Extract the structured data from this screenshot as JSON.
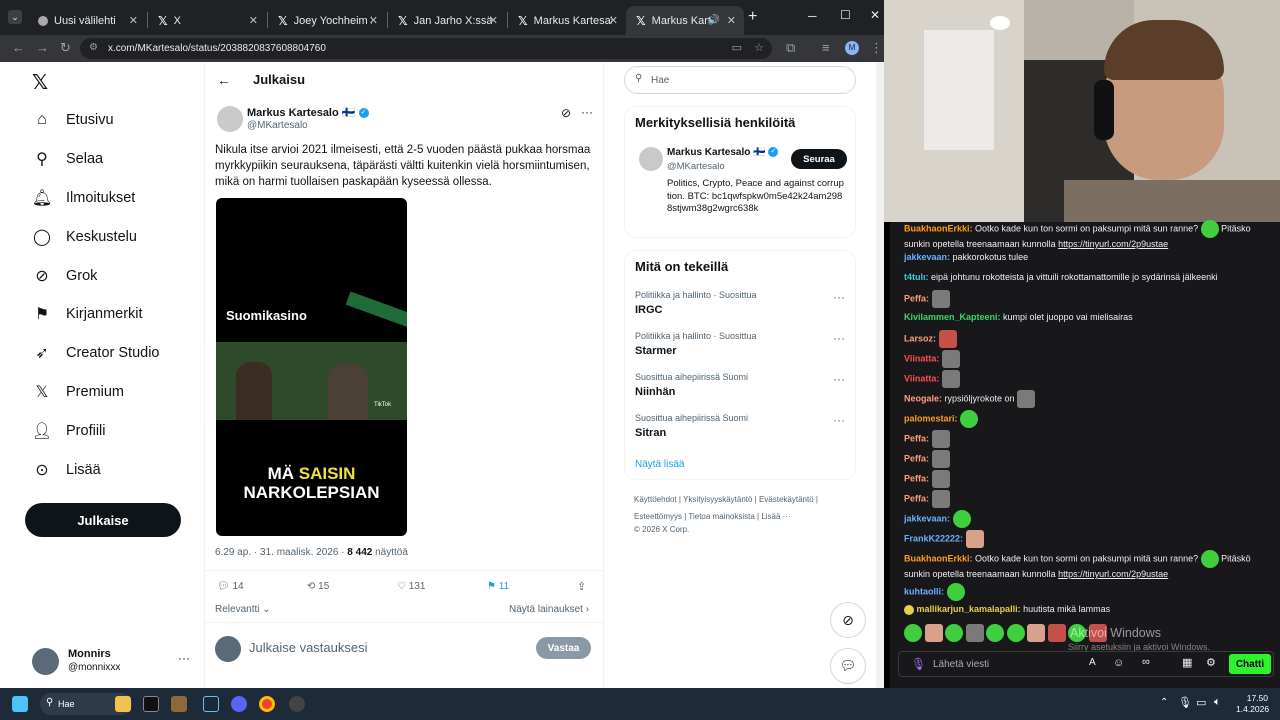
{
  "browser": {
    "tabs": [
      {
        "label": "Uusi välilehti"
      },
      {
        "label": "X"
      },
      {
        "label": "Joey Yochheim X:ssä"
      },
      {
        "label": "Jan Jarho X:ssä: \"Tän"
      },
      {
        "label": "Markus Kartesalo X"
      },
      {
        "label": "Markus Kartesalo X"
      }
    ],
    "url": "x.com/MKartesalo/status/2038820837608804760"
  },
  "leftnav": {
    "items": [
      {
        "label": "Etusivu",
        "icon": "home-icon"
      },
      {
        "label": "Selaa",
        "icon": "search-icon"
      },
      {
        "label": "Ilmoitukset",
        "icon": "bell-icon"
      },
      {
        "label": "Keskustelu",
        "icon": "chat-icon"
      },
      {
        "label": "Grok",
        "icon": "grok-icon"
      },
      {
        "label": "Kirjanmerkit",
        "icon": "bookmark-icon"
      },
      {
        "label": "Creator Studio",
        "icon": "rocket-icon"
      },
      {
        "label": "Premium",
        "icon": "x-icon"
      },
      {
        "label": "Profiili",
        "icon": "person-icon"
      },
      {
        "label": "Lisää",
        "icon": "more-circle-icon"
      }
    ],
    "post_label": "Julkaise",
    "account_name": "Monnirs",
    "account_handle": "@monnixxx"
  },
  "post": {
    "header_title": "Julkaisu",
    "author_name": "Markus Kartesalo 🇫🇮",
    "author_handle": "@MKartesalo",
    "text": "Nikula itse arvioi 2021 ilmeisesti, että 2-5 vuoden päästä pukkaa horsmaa myrkkypiikin seurauksena, täpärästi vältti kuitenkin vielä horsmiintumisen, mikä on harmi tuollaisen paskapään kyseessä ollessa.",
    "video_brand": "Suomikasino",
    "video_caption_white_1": "MÄ ",
    "video_caption_yellow": "SAISIN",
    "video_caption_white_2": "NARKOLEPSIAN",
    "video_tiktok": "TikTok",
    "meta_time": "6.29 ap. · 31. maalisk. 2026 · ",
    "meta_views": "8 442",
    "meta_views_label": " näyttöä",
    "replies": "14",
    "reposts": "15",
    "likes": "131",
    "bookmarks": "11",
    "sort_label": "Relevantti",
    "quotes_label": "Näytä lainaukset",
    "reply_placeholder": "Julkaise vastauksesi",
    "reply_button": "Vastaa"
  },
  "right": {
    "search_placeholder": "Hae",
    "relevant_title": "Merkityksellisiä henkilöitä",
    "person_name": "Markus Kartesalo 🇫🇮",
    "person_handle": "@MKartesalo",
    "person_bio": "Politics, Crypto, Peace and against corruption. BTC: bc1qwfspkw0m5e42k24am2988stjwm38g2wgrc638k",
    "follow_label": "Seuraa",
    "trending_title": "Mitä on tekeillä",
    "trends": [
      {
        "category": "Politiikka ja hallinto · Suosittua",
        "name": "IRGC"
      },
      {
        "category": "Politiikka ja hallinto · Suosittua",
        "name": "Starmer"
      },
      {
        "category": "Suosittua aihepiirissä Suomi",
        "name": "Niinhän"
      },
      {
        "category": "Suosittua aihepiirissä Suomi",
        "name": "Sitran"
      }
    ],
    "show_more": "Näytä lisää",
    "footer_1": "Käyttöehdot  |  Yksityisyyskäytäntö  |  Evästekäytäntö  |",
    "footer_2": "Esteettömyys  |  Tietoa mainoksista  |  Lisää ···",
    "footer_3": "© 2026 X Corp."
  },
  "chat": {
    "lines": [
      {
        "user": "BuakhaonErkki:",
        "color": "#ff9f1c",
        "text": " Ootko kade kun ton sormi on paksumpi mitä sun ranne? ",
        "link": "https://tinyurl.com/2p9ustae",
        "text2": " Pitäsko sunkin opetella treenaamaan kunnolla "
      },
      {
        "user": "jakkevaan:",
        "color": "#6ab0ff",
        "text": " pakkorokotus tulee"
      },
      {
        "user": "t4tulı:",
        "color": "#48c4d8",
        "text": " eipä johtunu rokotteista ja vittuili rokottamattomille jo sydärinsä jälkeenki"
      },
      {
        "user": "Peffa:",
        "color": "#ff9d7a",
        "text": ""
      },
      {
        "user": "Kivilammen_Kapteeni:",
        "color": "#3ad46b",
        "text": " kumpi olet juoppo vai mielisairas"
      },
      {
        "user": "Larsoz:",
        "color": "#ff9d7a",
        "text": ""
      },
      {
        "user": "Viinatta:",
        "color": "#ff4d4d",
        "text": ""
      },
      {
        "user": "Viinatta:",
        "color": "#ff4d4d",
        "text": ""
      },
      {
        "user": "Neogale:",
        "color": "#ff9d7a",
        "text": " rypsiöljyrokote on "
      },
      {
        "user": "palomestari:",
        "color": "#ff9f1c",
        "text": ""
      },
      {
        "user": "Peffa:",
        "color": "#ff9d7a",
        "text": ""
      },
      {
        "user": "Peffa:",
        "color": "#ff9d7a",
        "text": ""
      },
      {
        "user": "Peffa:",
        "color": "#ff9d7a",
        "text": ""
      },
      {
        "user": "Peffa:",
        "color": "#ff9d7a",
        "text": ""
      },
      {
        "user": "jakkevaan:",
        "color": "#6ab0ff",
        "text": ""
      },
      {
        "user": "FrankK22222:",
        "color": "#6ab0ff",
        "text": ""
      },
      {
        "user": "BuakhaonErkki:",
        "color": "#ff9f1c",
        "text": " Ootko kade kun ton sormi on paksumpi mitä sun ranne? ",
        "text2": " Pitäskö sunkin opetella treenaamaan kunnolla ",
        "link": "https://tinyurl.com/2p9ustae"
      },
      {
        "user": "kuhtaolli:",
        "color": "#6ab0ff",
        "text": ""
      },
      {
        "user": "mallikarjun_kamalapalli:",
        "color": "#e6cf4a",
        "text": " huutista mikä lammas"
      }
    ],
    "input_placeholder": "Lähetä viesti",
    "send_label": "Chatti"
  },
  "watermark": {
    "line1": "Aktivoi Windows",
    "line2": "Siirry asetuksiin ja aktivoi Windows."
  },
  "taskbar": {
    "search_label": "Hae",
    "time": "17.50",
    "date": "1.4.2026"
  }
}
